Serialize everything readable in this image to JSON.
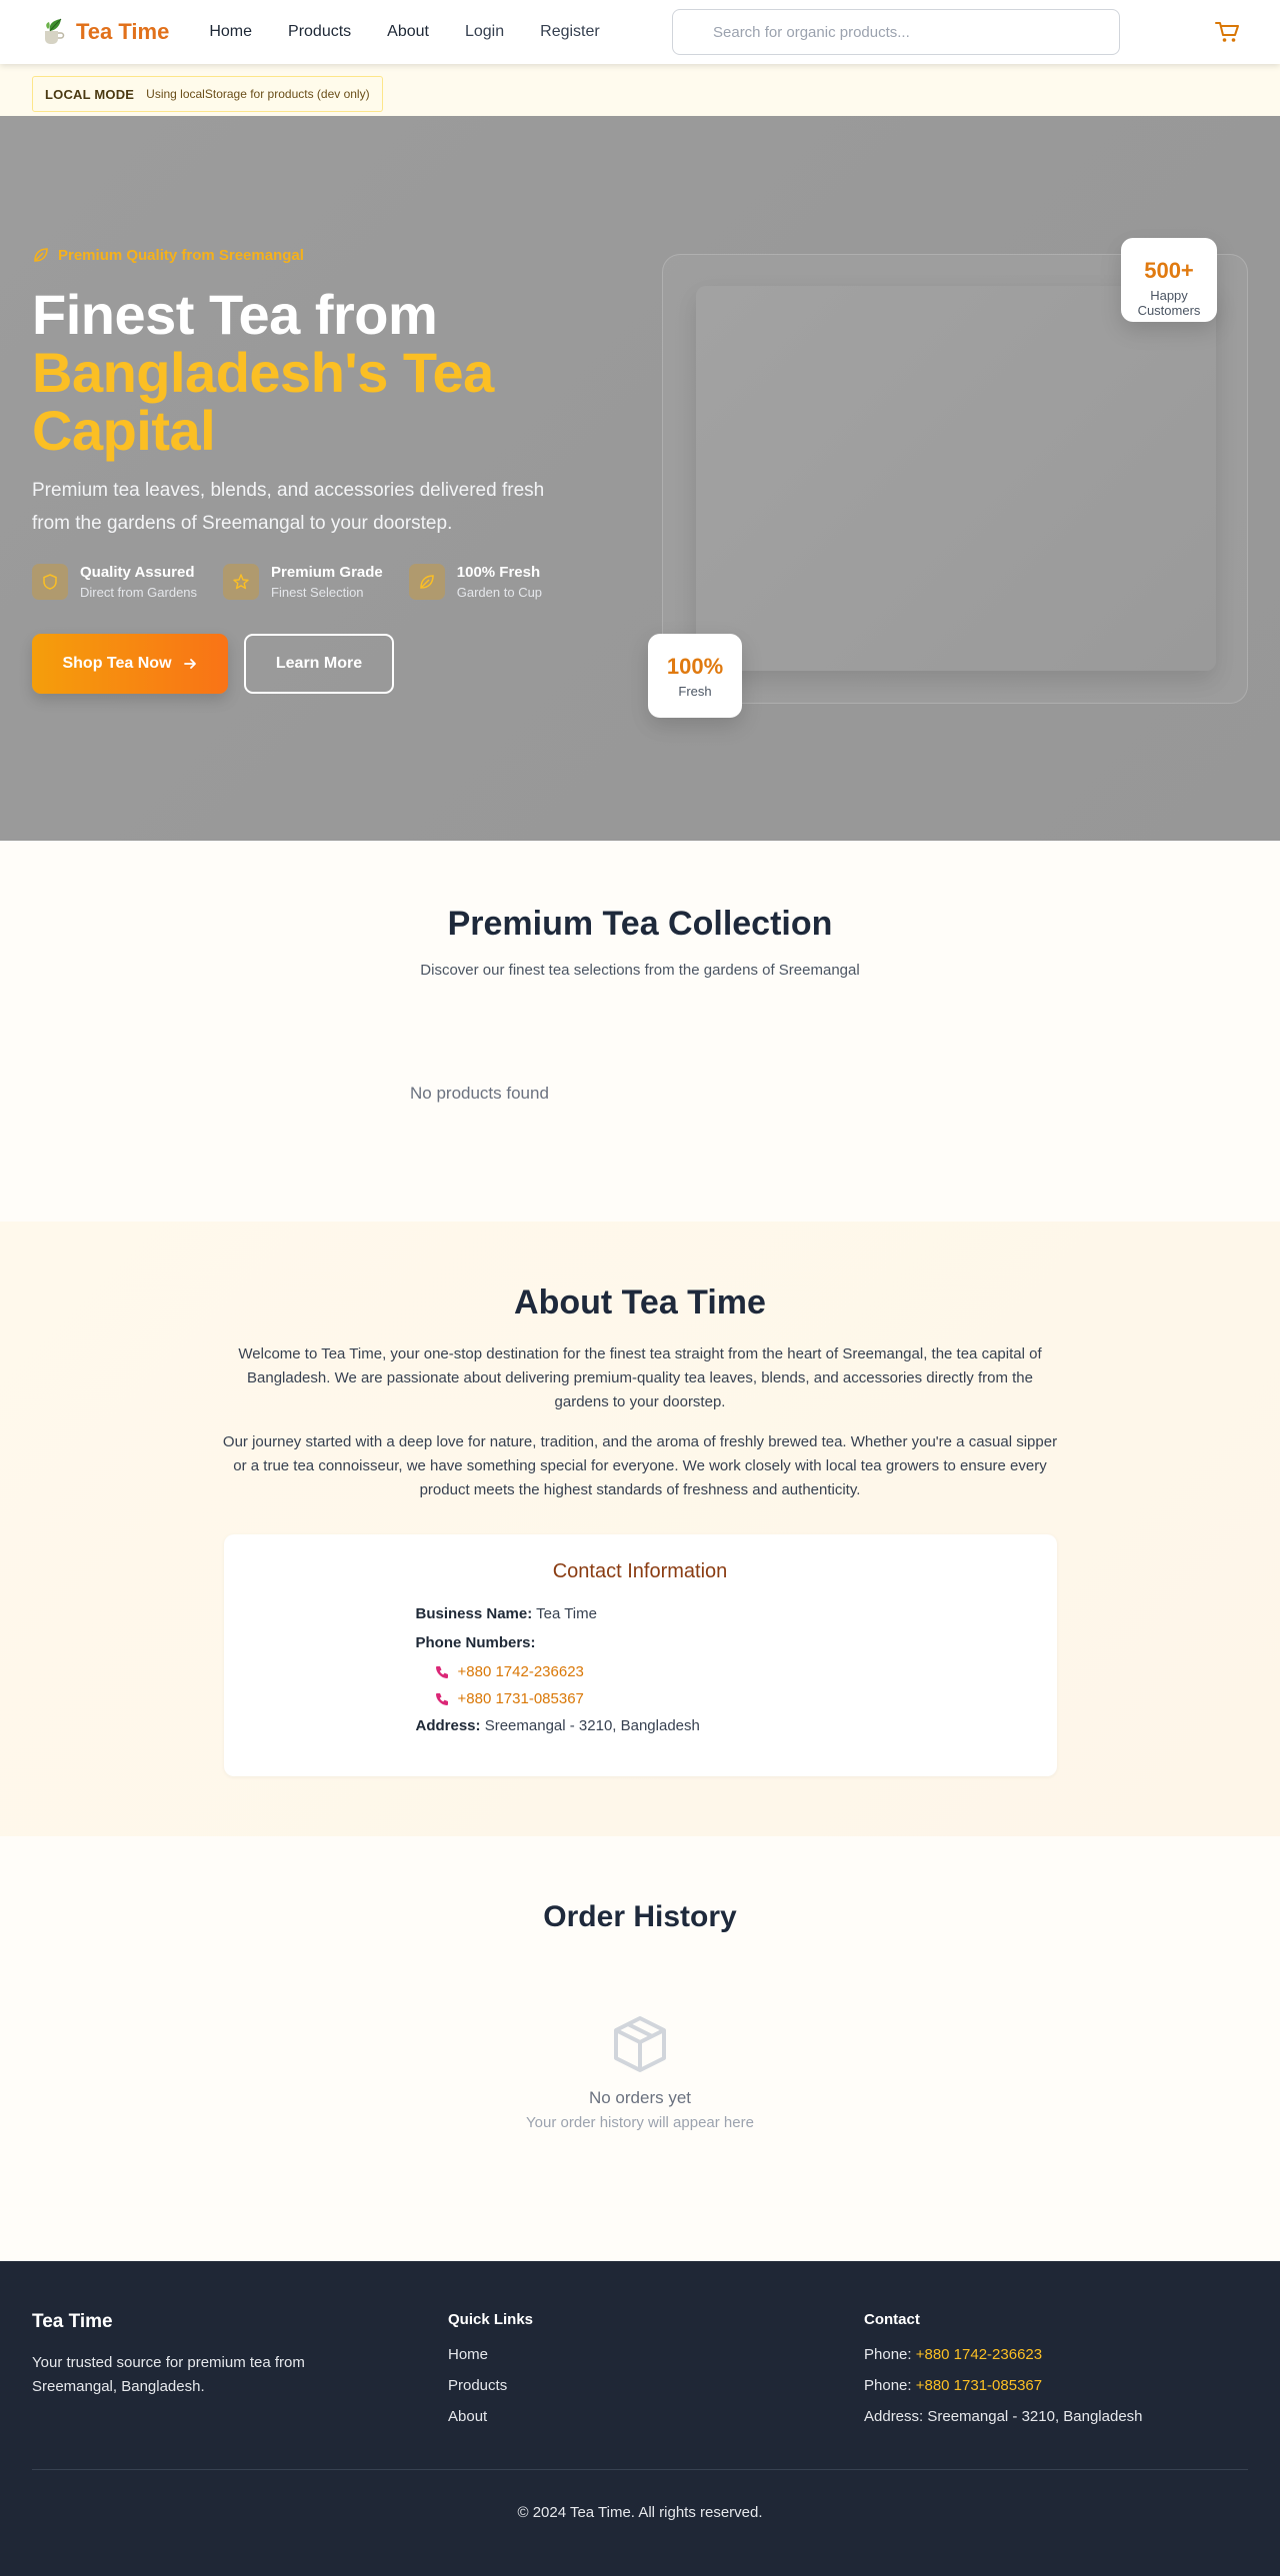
{
  "colors": {
    "brand": "#e1711b",
    "accent": "#fbbf24",
    "footer_bg": "#1f2736"
  },
  "header": {
    "brand_name": "Tea Time",
    "logo_icon": "tea-leaf-logo",
    "nav": [
      "Home",
      "Products",
      "About",
      "Login",
      "Register"
    ],
    "search_placeholder": "Search for organic products...",
    "cart_icon": "cart-icon"
  },
  "local_mode": {
    "label": "LOCAL MODE",
    "detail": "Using localStorage for products (dev only)"
  },
  "hero": {
    "eyebrow": "Premium Quality from Sreemangal",
    "title_line1": "Finest Tea from",
    "title_line2": "Bangladesh's Tea",
    "title_line3": "Capital",
    "subtitle": "Premium tea leaves, blends, and accessories delivered fresh from the gardens of Sreemangal to your doorstep.",
    "features": [
      {
        "title": "Quality Assured",
        "sub": "Direct from Gardens",
        "icon": "shield-icon"
      },
      {
        "title": "Premium Grade",
        "sub": "Finest Selection",
        "icon": "star-icon"
      },
      {
        "title": "100% Fresh",
        "sub": "Garden to Cup",
        "icon": "leaf-icon"
      }
    ],
    "primary_button": "Shop Tea Now",
    "secondary_button": "Learn More",
    "stat_customers_value": "500+",
    "stat_customers_label": "Happy Customers",
    "stat_fresh_value": "100%",
    "stat_fresh_label": "Fresh"
  },
  "products": {
    "title": "Premium Tea Collection",
    "subtitle": "Discover our finest tea selections from the gardens of Sreemangal",
    "empty": "No products found"
  },
  "about": {
    "title": "About Tea Time",
    "p1": "Welcome to Tea Time, your one-stop destination for the finest tea straight from the heart of Sreemangal, the tea capital of Bangladesh. We are passionate about delivering premium-quality tea leaves, blends, and accessories directly from the gardens to your doorstep.",
    "p2": "Our journey started with a deep love for nature, tradition, and the aroma of freshly brewed tea. Whether you're a casual sipper or a true tea connoisseur, we have something special for everyone. We work closely with local tea growers to ensure every product meets the highest standards of freshness and authenticity.",
    "contact": {
      "title": "Contact Information",
      "business_label": "Business Name:",
      "business_value": "Tea Time",
      "phones_label": "Phone Numbers:",
      "phones": [
        "+880 1742-236623",
        "+880 1731-085367"
      ],
      "address_label": "Address:",
      "address_value": "Sreemangal - 3210, Bangladesh"
    }
  },
  "orders": {
    "title": "Order History",
    "empty": "No orders yet",
    "empty_sub": "Your order history will appear here"
  },
  "footer": {
    "brand": "Tea Time",
    "description": "Your trusted source for premium tea from Sreemangal, Bangladesh.",
    "links_title": "Quick Links",
    "links": [
      "Home",
      "Products",
      "About"
    ],
    "contact_title": "Contact",
    "phone_label": "Phone:",
    "phones": [
      "+880 1742-236623",
      "+880 1731-085367"
    ],
    "address": "Address: Sreemangal - 3210, Bangladesh",
    "copyright": "© 2024 Tea Time. All rights reserved."
  }
}
